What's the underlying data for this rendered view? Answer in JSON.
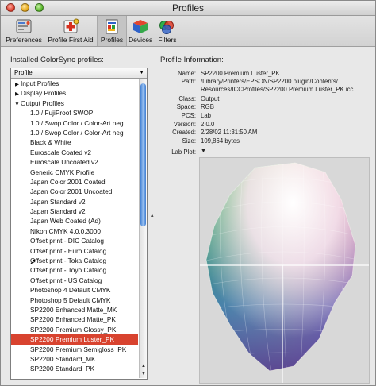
{
  "window": {
    "title": "Profiles"
  },
  "toolbar": {
    "items": [
      {
        "label": "Preferences",
        "icon": "preferences-icon"
      },
      {
        "label": "Profile First Aid",
        "icon": "first-aid-icon"
      },
      {
        "label": "Profiles",
        "icon": "profiles-icon",
        "selected": true
      },
      {
        "label": "Devices",
        "icon": "devices-icon"
      },
      {
        "label": "Filters",
        "icon": "filters-icon"
      }
    ]
  },
  "left": {
    "heading": "Installed ColorSync profiles:",
    "popup_value": "Profile",
    "rows": [
      {
        "label": "Input Profiles",
        "group": true,
        "expanded": false
      },
      {
        "label": "Display Profiles",
        "group": true,
        "expanded": false
      },
      {
        "label": "Output Profiles",
        "group": true,
        "expanded": true
      },
      {
        "label": "1.0 / FujiProof SWOP"
      },
      {
        "label": "1.0 / Swop Color / Color-Art neg"
      },
      {
        "label": "1.0 / Swop Color / Color-Art neg"
      },
      {
        "label": "Black & White"
      },
      {
        "label": "Euroscale Coated v2"
      },
      {
        "label": "Euroscale Uncoated v2"
      },
      {
        "label": "Generic CMYK Profile"
      },
      {
        "label": "Japan Color 2001 Coated"
      },
      {
        "label": "Japan Color 2001 Uncoated"
      },
      {
        "label": "Japan Standard v2"
      },
      {
        "label": "Japan Standard v2"
      },
      {
        "label": "Japan Web Coated (Ad)"
      },
      {
        "label": "Nikon CMYK 4.0.0.3000"
      },
      {
        "label": "Offset print - DIC Catalog"
      },
      {
        "label": "Offset print - Euro Catalog"
      },
      {
        "label": "Offset print - Toka Catalog"
      },
      {
        "label": "Offset print - Toyo Catalog"
      },
      {
        "label": "Offset print - US Catalog"
      },
      {
        "label": "Photoshop 4 Default CMYK"
      },
      {
        "label": "Photoshop 5 Default CMYK"
      },
      {
        "label": "SP2200 Enhanced Matte_MK"
      },
      {
        "label": "SP2200 Enhanced Matte_PK"
      },
      {
        "label": "SP2200 Premium Glossy_PK"
      },
      {
        "label": "SP2200 Premium Luster_PK",
        "selected": true
      },
      {
        "label": "SP2200 Premium Semigloss_PK"
      },
      {
        "label": "SP2200 Standard_MK"
      },
      {
        "label": "SP2200 Standard_PK"
      }
    ]
  },
  "info": {
    "heading": "Profile Information:",
    "fields": [
      {
        "label": "Name:",
        "value": "SP2200 Premium Luster_PK"
      },
      {
        "label": "Path:",
        "value": "/Library/Printers/EPSON/SP2200.plugin/Contents/"
      },
      {
        "label": "",
        "value": "Resources/ICCProfiles/SP2200 Premium Luster_PK.icc"
      },
      {
        "label": "Class:",
        "value": "Output"
      },
      {
        "label": "Space:",
        "value": "RGB"
      },
      {
        "label": "PCS:",
        "value": "Lab"
      },
      {
        "label": "Version:",
        "value": "2.0.0"
      },
      {
        "label": "Created:",
        "value": "2/28/02 11:31:50 AM"
      },
      {
        "label": "Size:",
        "value": "109,864 bytes"
      }
    ],
    "lab_plot_label": "Lab Plot:"
  },
  "colors": {
    "selection": "#d8432f",
    "scroll_thumb": "#3f7ed3",
    "plot_background": "#d8d8d8"
  }
}
